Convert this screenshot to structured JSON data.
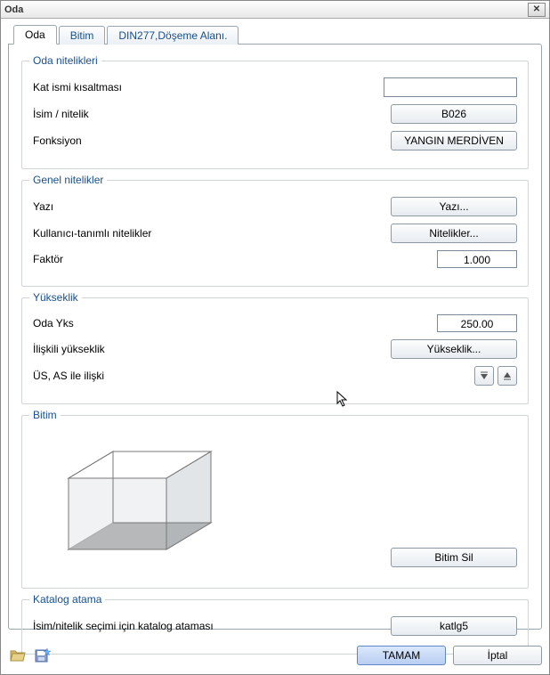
{
  "window": {
    "title": "Oda",
    "close": "X"
  },
  "tabs": {
    "t0": "Oda",
    "t1": "Bitim",
    "t2": "DIN277,Döşeme Alanı."
  },
  "group_oda": {
    "legend": "Oda nitelikleri",
    "kat_label": "Kat ismi kısaltması",
    "kat_value": "",
    "isim_label": "İsim / nitelik",
    "isim_btn": "B026",
    "fonk_label": "Fonksiyon",
    "fonk_btn": "YANGIN MERDİVEN"
  },
  "group_genel": {
    "legend": "Genel nitelikler",
    "yazi_label": "Yazı",
    "yazi_btn": "Yazı...",
    "kullanici_label": "Kullanıcı-tanımlı nitelikler",
    "kullanici_btn": "Nitelikler...",
    "faktor_label": "Faktör",
    "faktor_value": "1.000"
  },
  "group_yuk": {
    "legend": "Yükseklik",
    "oda_label": "Oda Yks",
    "oda_value": "250.00",
    "iliskili_label": "İlişkili yükseklik",
    "iliskili_btn": "Yükseklik...",
    "usas_label": "ÜS, AS ile ilişki"
  },
  "group_bitim": {
    "legend": "Bitim",
    "sil_btn": "Bitim Sil"
  },
  "group_katalog": {
    "legend": "Katalog atama",
    "label": "İsim/nitelik seçimi için katalog ataması",
    "btn": "katlg5"
  },
  "footer": {
    "ok": "TAMAM",
    "cancel": "İptal"
  }
}
